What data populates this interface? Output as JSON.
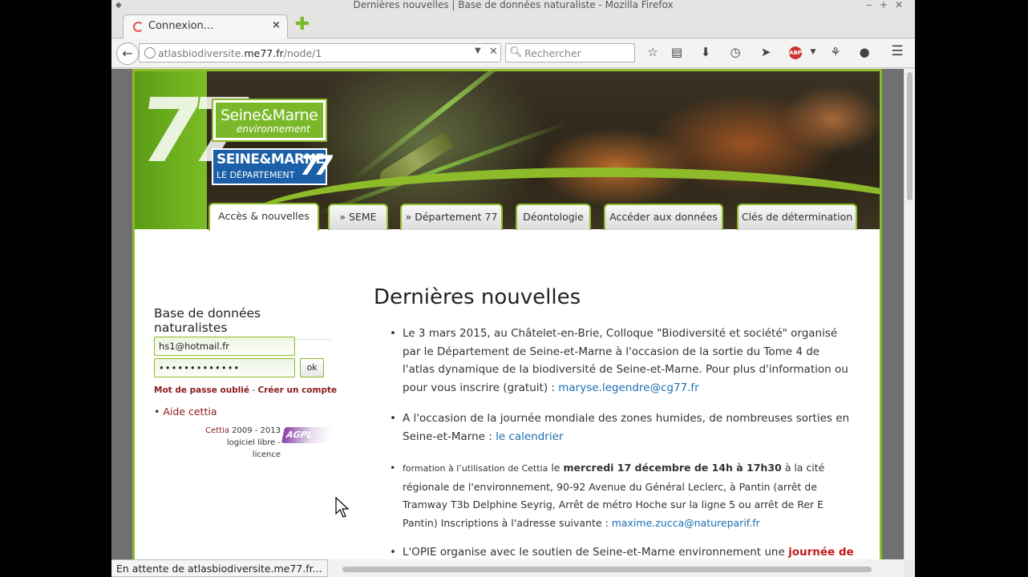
{
  "window": {
    "title": "Dernières nouvelles | Base de données naturaliste - Mozilla Firefox"
  },
  "tabs": [
    {
      "label": "Connexion...",
      "close": "×"
    }
  ],
  "newtab_label": "✚",
  "navbar": {
    "back": "←",
    "url_prefix": "atlasbiodiversite.",
    "url_domain": "me77.fr",
    "url_path": "/node/1",
    "url_dropdown": "▼",
    "url_clear": "✕",
    "search_placeholder": "Rechercher",
    "search_icon": "search-icon"
  },
  "toolbar_icons": [
    "star-icon",
    "reading-list-icon",
    "download-icon",
    "history-icon",
    "send-icon",
    "adblock-icon",
    "dropdown-icon",
    "share-icon",
    "chat-icon",
    "menu-icon"
  ],
  "header": {
    "logo_sme_line1": "Seine&Marne",
    "logo_sme_line2": "environnement",
    "logo_dep_line1": "SEINE&MARNE",
    "logo_dep_line2": "LE DÉPARTEMENT",
    "logo_dep_num": "77",
    "banner_number": "77",
    "menu": [
      {
        "label": "Accès & nouvelles",
        "active": true
      },
      {
        "label": "» SEME",
        "active": false
      },
      {
        "label": "» Département 77",
        "active": false
      },
      {
        "label": "Déontologie",
        "active": false
      },
      {
        "label": "Accéder aux données",
        "active": false
      },
      {
        "label": "Clés de détermination",
        "active": false
      }
    ]
  },
  "sidebar": {
    "title": "Base de données naturalistes",
    "email_value": "hs1@hotmail.fr",
    "password_mask": "•••••••••••••",
    "ok_label": "ok",
    "forgot_label": "Mot de passe oublié",
    "separator": " - ",
    "create_label": "Créer un compte",
    "aide_bullet": "•",
    "aide_label": "Aide cettia",
    "copy_brand": "Cettia",
    "copy_years": " 2009 - 2013",
    "copy_line2": "logiciel libre - licence",
    "agpl_label": "AGPL"
  },
  "main": {
    "title": "Dernières nouvelles",
    "news": [
      {
        "text": "Le 3 mars 2015, au Châtelet-en-Brie, Colloque \"Biodiversité et société\" organisé par le Département de Seine-et-Marne à l'occasion de la sortie du Tome 4 de l'atlas dynamique de la biodiversité de Seine-et-Marne. Pour plus d'information ou pour vous inscrire (gratuit) : ",
        "link": "maryse.legendre@cg77.fr"
      },
      {
        "text": "A l'occasion de la journée mondiale des zones humides, de nombreuses sorties en Seine-et-Marne : ",
        "link": "le calendrier"
      },
      {
        "lead": "formation à l’utilisation de Cettia",
        "le": " le ",
        "date": "mercredi 17 décembre de 14h à 17h30",
        "rest": " à la cité régionale de l'environnement, 90-92 Avenue du Général Leclerc, à Pantin (arrêt de Tramway T3b Delphine Seyrig, Arrêt de métro Hoche sur la ligne 5 ou arrêt de Rer E Pantin) Inscriptions à l'adresse suivante : ",
        "link": "maxime.zucca@natureparif.fr"
      },
      {
        "text": "L'OPIE organise avec le soutien de Seine-et-Marne environnement une ",
        "highlight": "journée de"
      }
    ]
  },
  "statusbar": {
    "text": "En attente de atlasbiodiversite.me77.fr..."
  },
  "colors": {
    "brand_green": "#8dbb2a",
    "link_blue": "#1b6fb3",
    "dark_red": "#8b1a1a",
    "highlight_red": "#c41a1a",
    "department_blue": "#1a5fa8"
  }
}
